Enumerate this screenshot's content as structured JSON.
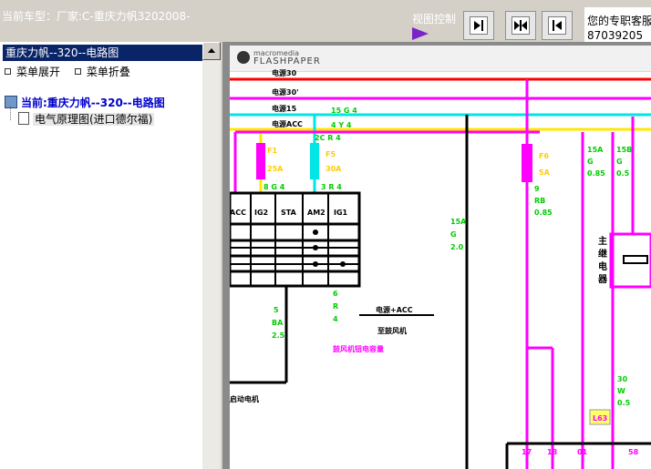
{
  "header": {
    "car_model_text": "当前车型：厂家:C-重庆力帆3202008-",
    "view_control_label": "视图控制",
    "contact_line1": "您的专职客服",
    "contact_line2": "87039205"
  },
  "view_buttons": [
    {
      "name": "collapse-left-button",
      "icon": "arrow-to-right-icon"
    },
    {
      "name": "split-view-button",
      "icon": "arrows-inward-icon"
    },
    {
      "name": "collapse-right-button",
      "icon": "arrow-to-left-icon"
    }
  ],
  "left_panel": {
    "header_title": "重庆力帆--320--电路图",
    "expand_label": "菜单展开",
    "collapse_label": "菜单折叠",
    "tree_root_label": "当前:重庆力帆--320--电路图",
    "tree_child_label": "电气原理图(进口德尔福)"
  },
  "viewer": {
    "brand_top": "macromedia",
    "brand_bottom": "FLASHPAPER"
  },
  "diagram": {
    "labels": {
      "bat30": "电源30",
      "bat30p": "电源30'",
      "ig15": "电源15",
      "acc": "电源ACC",
      "wire_15g4": "15 G 4",
      "wire_4y4": "4 Y 4",
      "f1": "F1",
      "f1a": "25A",
      "f5": "F5",
      "f5a": "30A",
      "f6": "F6",
      "f6a": "5A",
      "wire_8g4": "8 G 4",
      "wire_3r4": "3 R 4",
      "wire_2cr4": "2C R 4",
      "sw_acc": "ACC",
      "sw_ig2": "IG2",
      "sw_sta": "STA",
      "sw_am2": "AM2",
      "sw_ig1": "IG1",
      "w5": "5",
      "w5b": "BA",
      "w5c": "2.5",
      "w6": "6",
      "w6b": "R",
      "w6c": "4",
      "acc_power": "电源+ACC",
      "to_blower": "至鼓风机",
      "blower_cap": "鼓风机钮电容量",
      "starter": "启动电机",
      "w15a": "15A",
      "w15b": "G",
      "w15c": "2.0",
      "w9": "9",
      "w9b": "RB",
      "w9c": "0.85",
      "w15a2": "15A",
      "w15b2": "G",
      "w15c2": "0.85",
      "w15s": "15B",
      "w15sb": "G",
      "w15sc": "0.5",
      "relay1": "主",
      "relay2": "继",
      "relay3": "电",
      "relay4": "器",
      "w30": "30",
      "w30b": "W",
      "w30c": "0.5",
      "conn_tag": "L63",
      "pin17": "17",
      "pin18": "18",
      "pin01": "01",
      "pin58": "58"
    }
  }
}
